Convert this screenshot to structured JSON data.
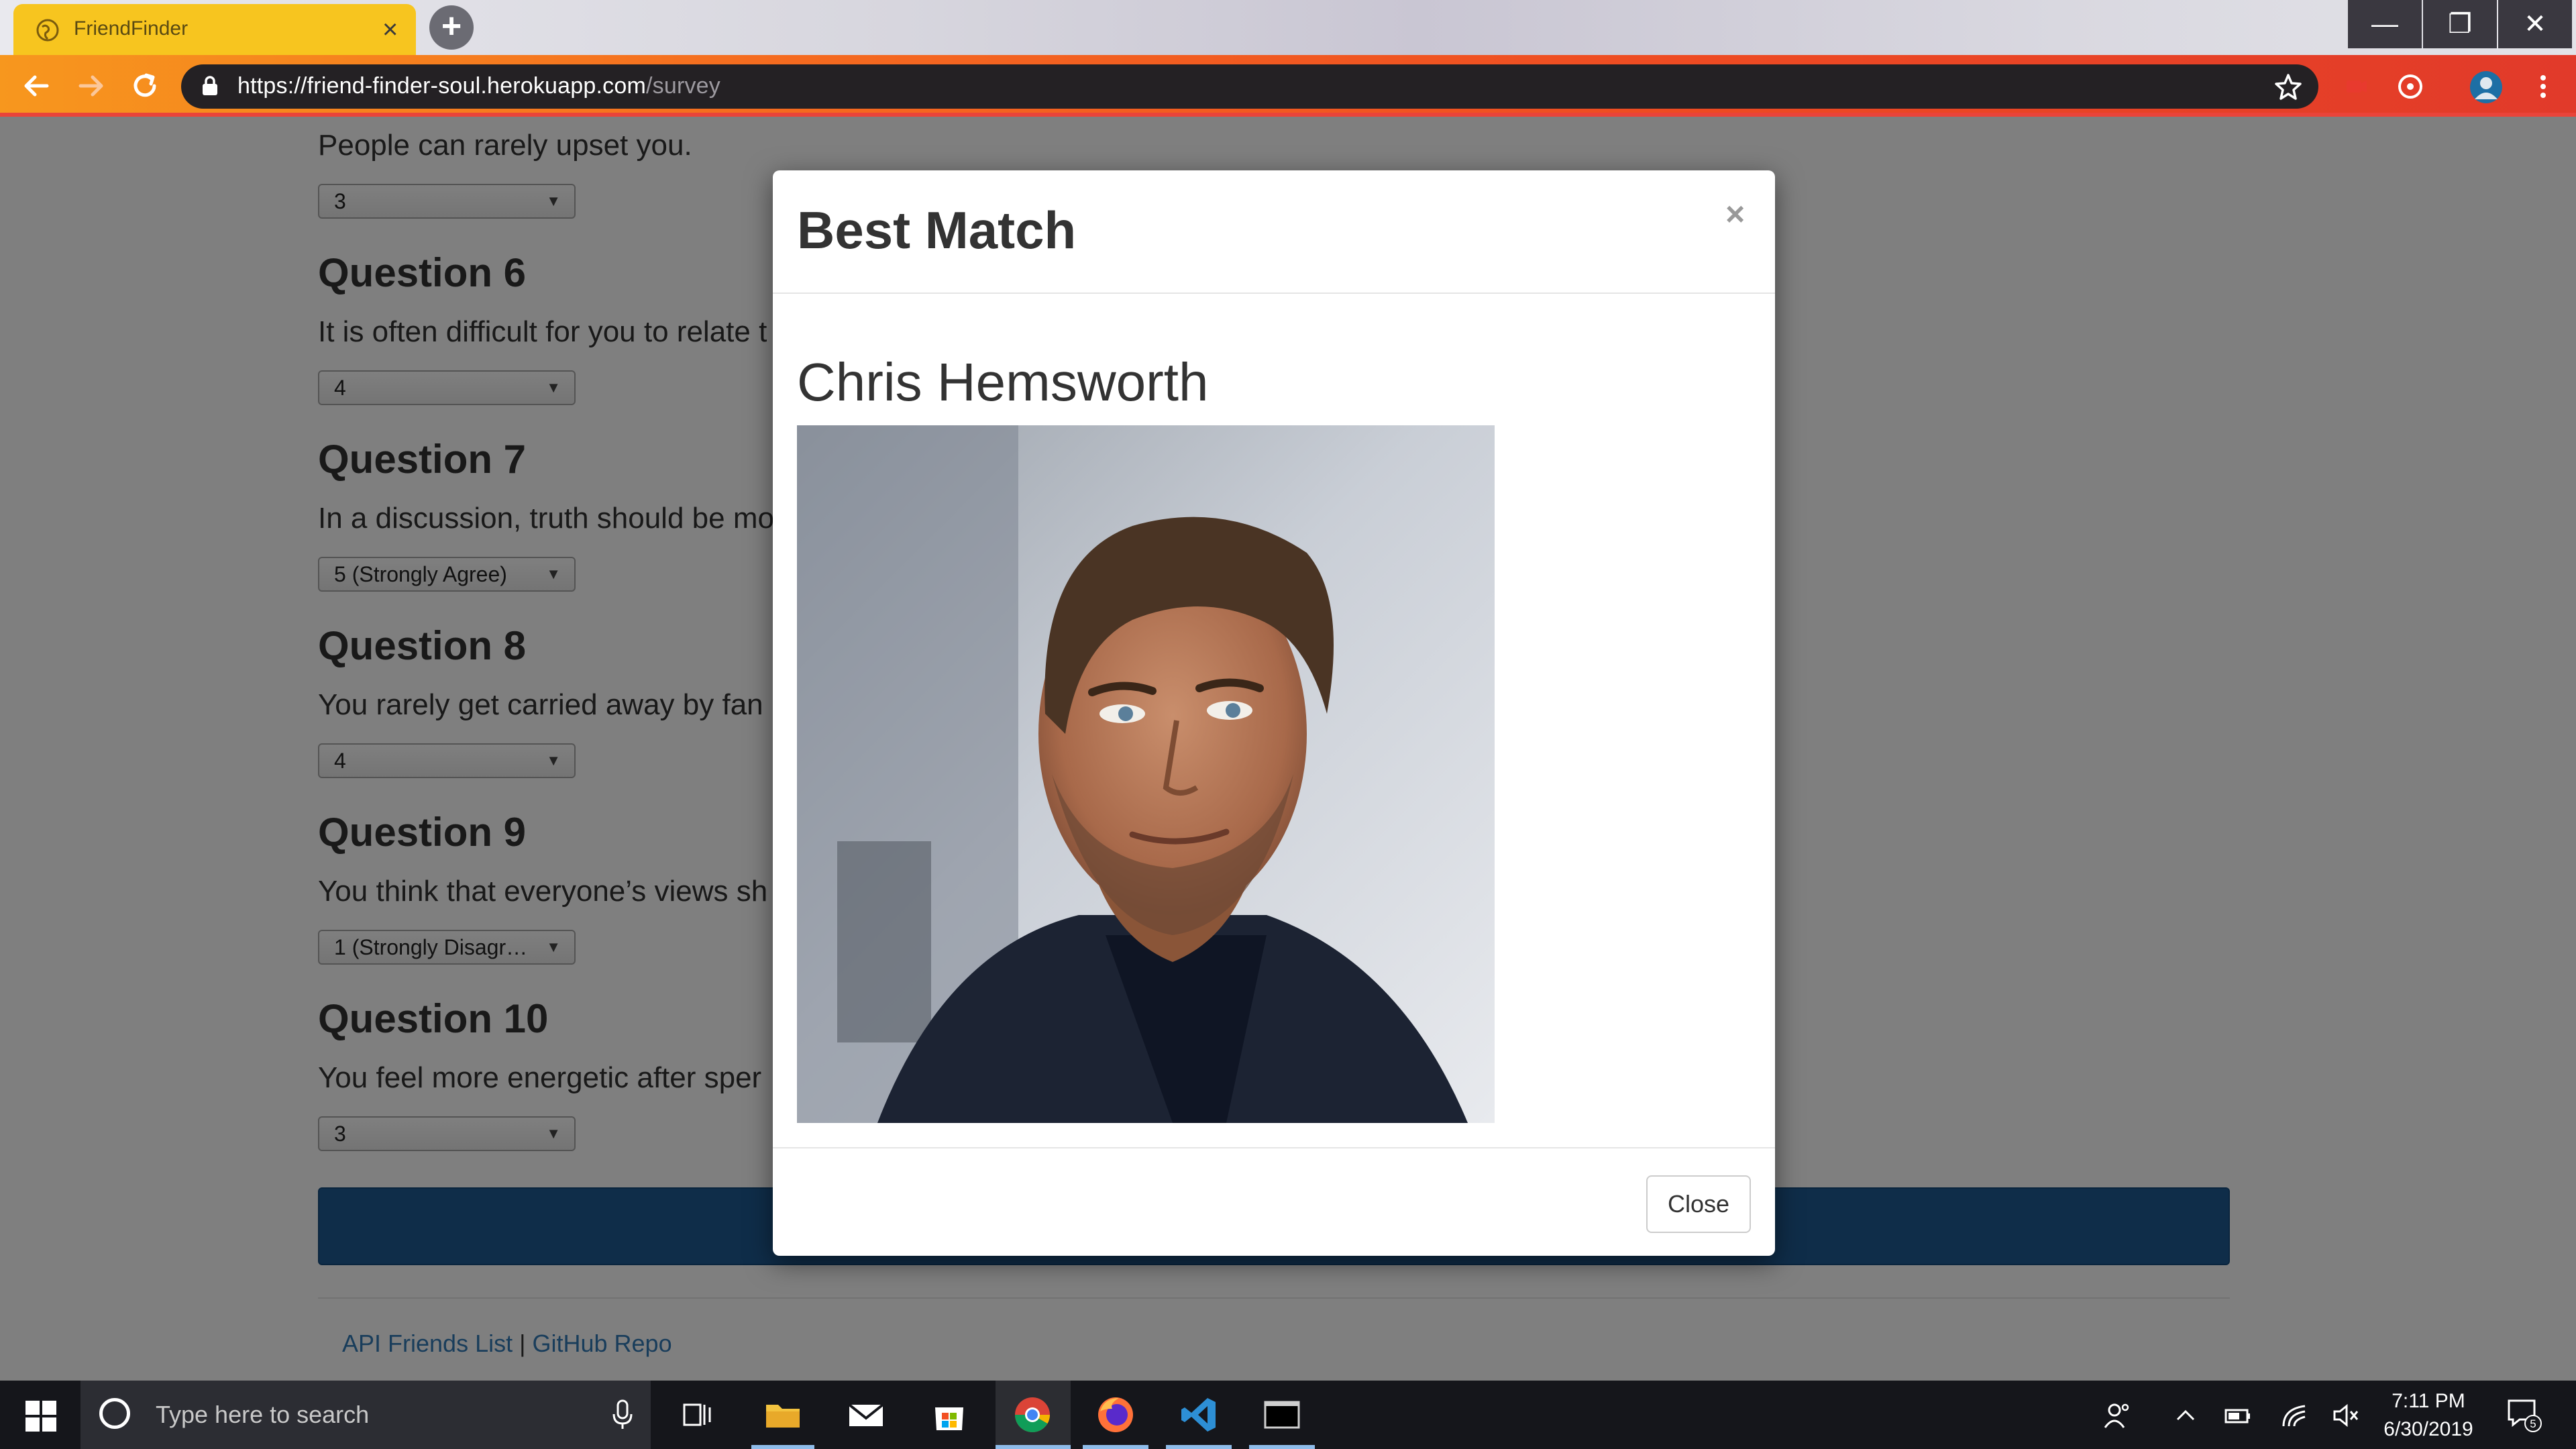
{
  "browser": {
    "tab_title": "FriendFinder",
    "url_host": "https://friend-finder-soul.herokuapp.com",
    "url_path": "/survey",
    "window_buttons": [
      "—",
      "❐",
      "✕"
    ]
  },
  "survey": {
    "partial_text_top": "People can rarely upset you.",
    "questions": [
      {
        "heading": "Question 6",
        "text": "It is often difficult for you to relate t",
        "value": "4"
      },
      {
        "heading": "Question 7",
        "text": "In a discussion, truth should be mo",
        "value": "5 (Strongly Agree)"
      },
      {
        "heading": "Question 8",
        "text": "You rarely get carried away by fan",
        "value": "4"
      },
      {
        "heading": "Question 9",
        "text": "You think that everyone’s views sh",
        "value": "1 (Strongly Disagr…"
      },
      {
        "heading": "Question 10",
        "text": "You feel more energetic after sper",
        "value": "3"
      }
    ],
    "top_select_value": "3",
    "trailing_fragment": "."
  },
  "footer": {
    "api_link": "API Friends List",
    "separator": "|",
    "github_link": "GitHub Repo"
  },
  "modal": {
    "title": "Best Match",
    "close_x": "×",
    "match_name": "Chris Hemsworth",
    "close_button": "Close"
  },
  "taskbar": {
    "search_placeholder": "Type here to search",
    "time": "7:11 PM",
    "date": "6/30/2019",
    "notification_count": "5"
  },
  "colors": {
    "tab_yellow": "#f7c51f",
    "toolbar_orange": "#f56b1f",
    "submit_blue": "#1f5a93",
    "link_blue": "#337ab7"
  }
}
